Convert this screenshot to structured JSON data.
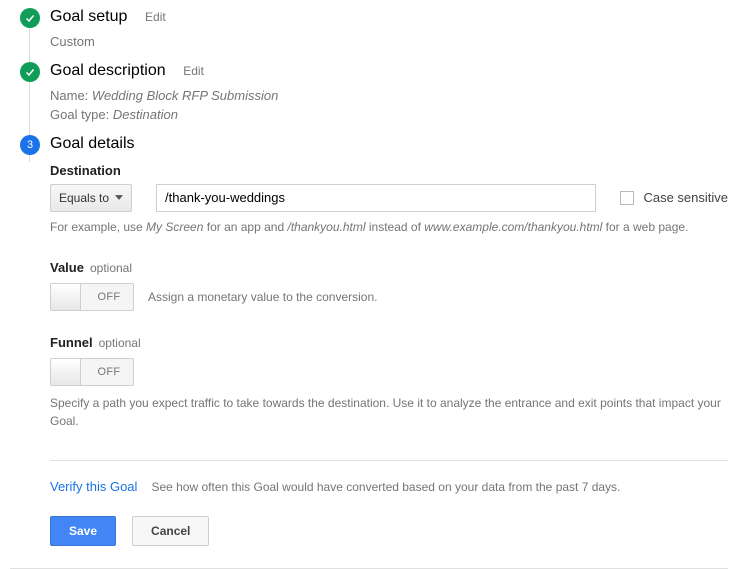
{
  "steps": {
    "setup": {
      "title": "Goal setup",
      "edit": "Edit",
      "sub": "Custom"
    },
    "desc": {
      "title": "Goal description",
      "edit": "Edit",
      "name_label": "Name:",
      "name_value": "Wedding Block RFP Submission",
      "type_label": "Goal type:",
      "type_value": "Destination"
    },
    "details": {
      "number": "3",
      "title": "Goal details"
    }
  },
  "destination": {
    "label": "Destination",
    "match_type": "Equals to",
    "value": "/thank-you-weddings",
    "case_sensitive": "Case sensitive",
    "hint_pre": "For example, use ",
    "hint_myscreen": "My Screen",
    "hint_mid1": " for an app and ",
    "hint_thankyou": "/thankyou.html",
    "hint_mid2": " instead of ",
    "hint_fullurl": "www.example.com/thankyou.html",
    "hint_post": " for a web page."
  },
  "value": {
    "label": "Value",
    "optional": "optional",
    "toggle": "OFF",
    "desc": "Assign a monetary value to the conversion."
  },
  "funnel": {
    "label": "Funnel",
    "optional": "optional",
    "toggle": "OFF",
    "desc": "Specify a path you expect traffic to take towards the destination. Use it to analyze the entrance and exit points that impact your Goal."
  },
  "verify": {
    "link": "Verify this Goal",
    "desc": "See how often this Goal would have converted based on your data from the past 7 days."
  },
  "buttons": {
    "save": "Save",
    "cancel": "Cancel"
  }
}
